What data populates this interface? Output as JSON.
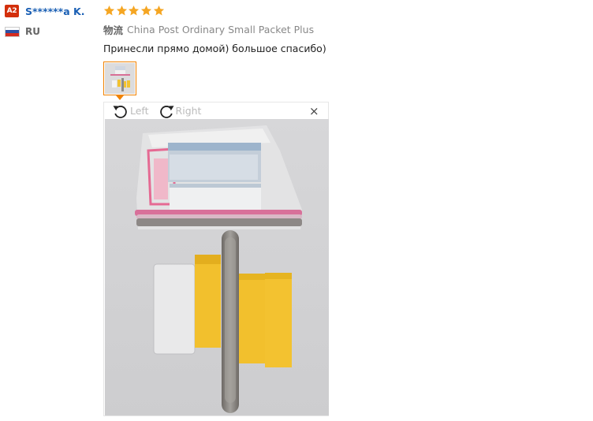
{
  "buyer": {
    "level_badge": "A2",
    "name": "S******a K.",
    "country": "RU"
  },
  "review": {
    "rating": 5,
    "max_rating": 5,
    "star_color": "#f5a623",
    "shipping_label": "物流",
    "shipping_method": "China Post Ordinary Small Packet Plus",
    "comment": "Принесли прямо домой) большое спасибо)"
  },
  "viewer": {
    "rotate_left_label": "Left",
    "rotate_right_label": "Right",
    "close_label": "×",
    "accent_color": "#f08200"
  }
}
